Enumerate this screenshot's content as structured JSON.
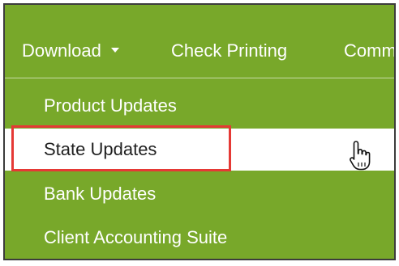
{
  "nav": {
    "download_label": "Download",
    "check_printing_label": "Check Printing",
    "comm_label": "Comm"
  },
  "menu": {
    "items": [
      {
        "label": "Product Updates"
      },
      {
        "label": "State Updates"
      },
      {
        "label": "Bank Updates"
      },
      {
        "label": "Client Accounting Suite"
      }
    ]
  },
  "colors": {
    "menu_green": "#78a82a",
    "highlight_red": "#e53935",
    "hover_bg": "#ffffff"
  },
  "icons": {
    "cursor": "hand-pointer-icon",
    "caret": "caret-down-icon"
  }
}
